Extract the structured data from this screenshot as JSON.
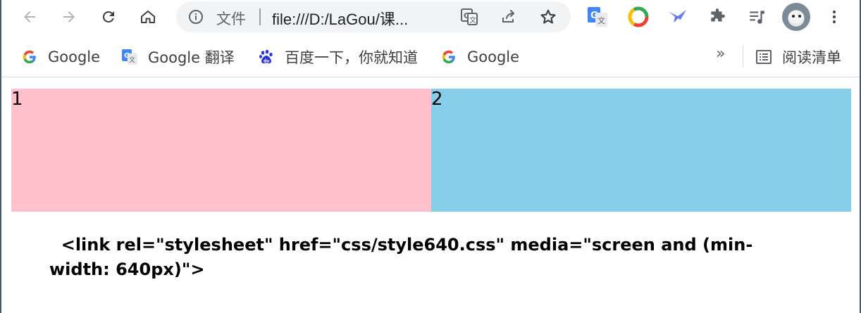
{
  "browser": {
    "omnibox": {
      "scheme_label": "文件",
      "url": "file:///D:/LaGou/课..."
    },
    "buttons": [
      "back",
      "forward",
      "reload",
      "home"
    ],
    "extensions": [
      "google-translate-icon",
      "chrome-circle-icon",
      "feather-extension-icon",
      "puzzle-icon",
      "media-playlist-icon"
    ]
  },
  "bookmarks": {
    "items": [
      {
        "label": "Google",
        "icon": "google-g-icon"
      },
      {
        "label": "Google 翻译",
        "icon": "google-translate-icon"
      },
      {
        "label": "百度一下，你就知道",
        "icon": "baidu-paw-icon"
      },
      {
        "label": "Google",
        "icon": "google-g-icon"
      }
    ],
    "overflow": "»",
    "reading_list": "阅读清单"
  },
  "page": {
    "box1": "1",
    "box2": "2",
    "code": "  <link rel=\"stylesheet\" href=\"css/style640.css\" media=\"screen and (min-width: 640px)\">"
  },
  "colors": {
    "box1": "#ffc0cb",
    "box2": "#87ceeb",
    "toolbar_bg": "#ffffff",
    "omnibox_bg": "#f1f3f4"
  }
}
